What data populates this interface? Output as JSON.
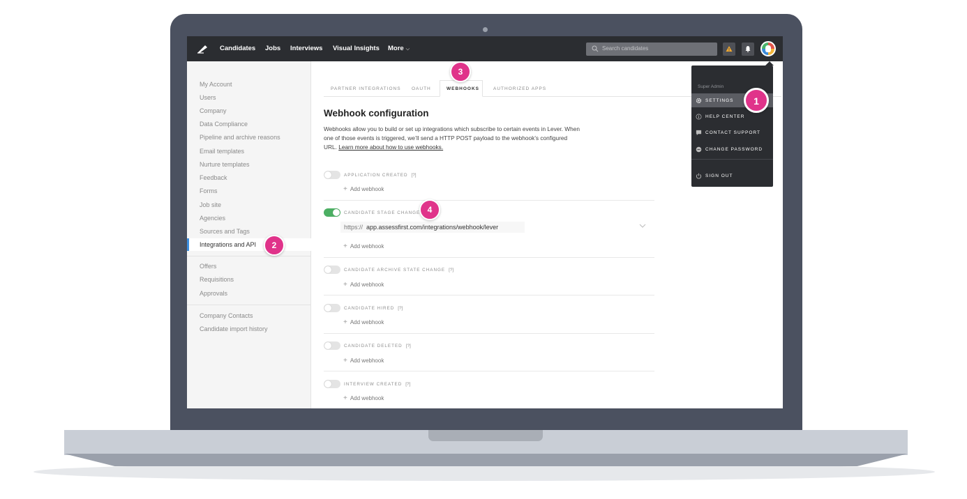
{
  "nav": {
    "items": [
      "Candidates",
      "Jobs",
      "Interviews",
      "Visual Insights",
      "More"
    ],
    "search_placeholder": "Search candidates"
  },
  "sidebar": {
    "items": [
      "My Account",
      "Users",
      "Company",
      "Data Compliance",
      "Pipeline and archive reasons",
      "Email templates",
      "Nurture templates",
      "Feedback",
      "Forms",
      "Job site",
      "Agencies",
      "Sources and Tags",
      "Integrations and API",
      "Offers",
      "Requisitions",
      "Approvals",
      "Company Contacts",
      "Candidate import history"
    ],
    "active_item": "Integrations and API"
  },
  "tabs": [
    "PARTNER INTEGRATIONS",
    "OAUTH",
    "WEBHOOKS",
    "AUTHORIZED APPS"
  ],
  "active_tab": "WEBHOOKS",
  "content": {
    "title": "Webhook configuration",
    "description_1": "Webhooks allow you to build or set up integrations which subscribe to certain events in Lever. When one of those events is triggered, we’ll send a HTTP POST payload to the webhook’s configured URL.",
    "description_link": "Learn more about how to use webhooks.",
    "add_webhook_label": "Add webhook",
    "help_marker": "[?]",
    "webhook_url_protocol": "https://",
    "webhook_url_value": "app.assessfirst.com/integrations/webhook/lever",
    "events": [
      {
        "label": "APPLICATION CREATED",
        "enabled": false
      },
      {
        "label": "CANDIDATE STAGE CHANGE",
        "enabled": true
      },
      {
        "label": "CANDIDATE ARCHIVE STATE CHANGE",
        "enabled": false
      },
      {
        "label": "CANDIDATE HIRED",
        "enabled": false
      },
      {
        "label": "CANDIDATE DELETED",
        "enabled": false
      },
      {
        "label": "INTERVIEW CREATED",
        "enabled": false
      }
    ]
  },
  "dropdown": {
    "role": "Super Admin",
    "items": [
      "SETTINGS",
      "HELP CENTER",
      "CONTACT SUPPORT",
      "CHANGE PASSWORD",
      "SIGN OUT"
    ],
    "active_item": "SETTINGS"
  },
  "callouts": [
    "1",
    "2",
    "3",
    "4"
  ],
  "colors": {
    "accent_blue": "#3d8fe0",
    "toggle_on": "#4caf63",
    "callout_pink": "#e0338a",
    "navbar": "#2b2d31"
  }
}
